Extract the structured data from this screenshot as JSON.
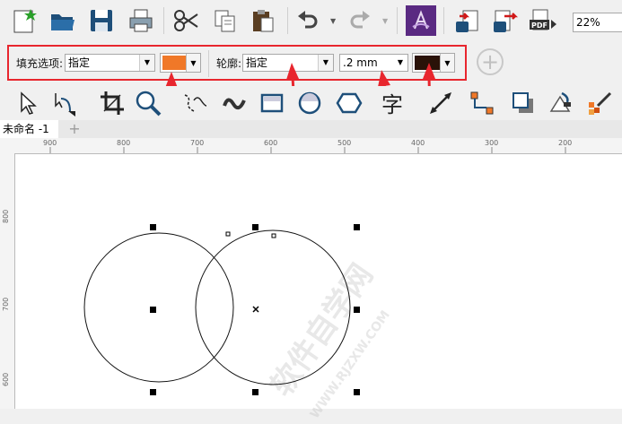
{
  "toolbar_main": {
    "zoom_value": "22%",
    "pdf_label": "PDF"
  },
  "property_bar": {
    "fill_label": "填充选项:",
    "fill_value": "指定",
    "fill_color": "#f07828",
    "outline_label": "轮廓:",
    "outline_value": "指定",
    "width_value": ".2 mm",
    "outline_color": "#2a1208"
  },
  "document_tab": {
    "name": "未命名 -1",
    "add_symbol": "+"
  },
  "ruler_horizontal": {
    "labels": [
      "900",
      "800",
      "700",
      "600",
      "500",
      "400",
      "300",
      "200"
    ]
  },
  "ruler_vertical": {
    "labels": [
      "800",
      "700",
      "600"
    ]
  },
  "watermark": {
    "text": "软件自学网",
    "subtext": "WWW.RJZXW.COM"
  },
  "colors": {
    "highlight_red": "#e8262e",
    "accent_purple": "#5a2a82"
  }
}
